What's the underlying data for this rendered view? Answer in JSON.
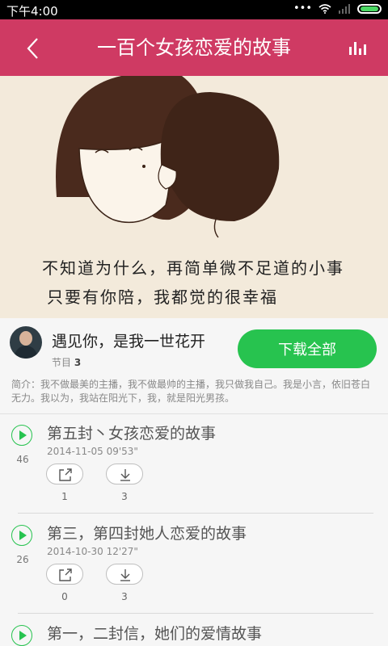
{
  "status": {
    "time": "下午4:00",
    "dots": "•••"
  },
  "header": {
    "title": "一百个女孩恋爱的故事",
    "back_icon": "chevron-left-icon",
    "chart_icon": "equalizer-icon"
  },
  "banner": {
    "line1": "不知道为什么，再简单微不足道的小事",
    "line2": "只要有你陪，我都觉的很幸福"
  },
  "program": {
    "title": "遇见你，是我一世花开",
    "episodes_label": "节目",
    "episodes_count": "3",
    "download_all": "下载全部",
    "intro": "简介：我不做最美的主播，我不做最帅的主播，我只做我自己。我是小言，依旧苍白无力。我以为，我站在阳光下，我，就是阳光男孩。"
  },
  "tracks": [
    {
      "title": "第五封丶女孩恋爱的故事",
      "date": "2014-11-05",
      "duration": "09'53\"",
      "plays": "46",
      "shares": "1",
      "downloads": "3"
    },
    {
      "title": "第三，第四封她人恋爱的故事",
      "date": "2014-10-30",
      "duration": "12'27\"",
      "plays": "26",
      "shares": "0",
      "downloads": "3"
    },
    {
      "title": "第一，二封信，她们的爱情故事",
      "date": "",
      "duration": "",
      "plays": "",
      "shares": "",
      "downloads": ""
    }
  ],
  "colors": {
    "accent": "#cf3a63",
    "green": "#27c34f"
  }
}
